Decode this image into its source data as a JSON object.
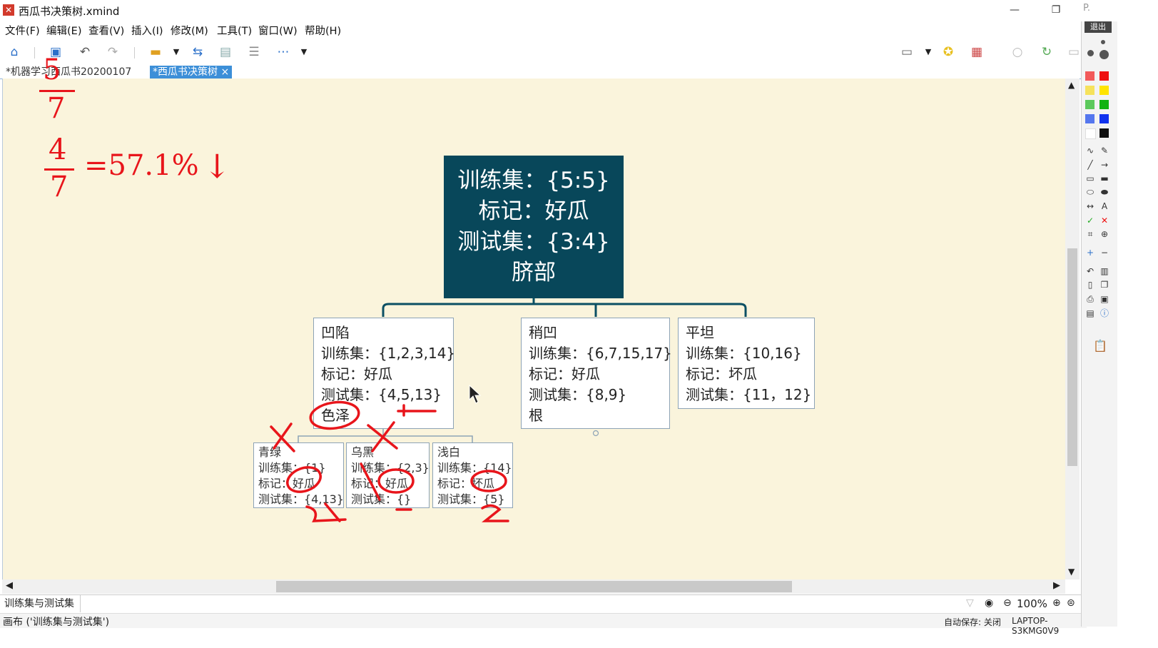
{
  "window": {
    "title": "西瓜书决策树.xmind",
    "minimize": "—",
    "restore": "❐",
    "close_tab_label": "P."
  },
  "menu": [
    "文件(F)",
    "编辑(E)",
    "查看(V)",
    "插入(I)",
    "修改(M)",
    "工具(T)",
    "窗口(W)",
    "帮助(H)"
  ],
  "tabs": [
    {
      "label": "*机器学习西瓜书20200107"
    },
    {
      "label": "*西瓜书决策树",
      "close": "×"
    }
  ],
  "mindmap": {
    "root": [
      "训练集：{5:5}",
      "标记：好瓜",
      "测试集：{3:4}",
      "脐部"
    ],
    "branches": [
      {
        "lines": [
          "凹陷",
          "训练集：{1,2,3,14}",
          "标记：好瓜",
          "测试集：{4,5,13}",
          "色泽"
        ]
      },
      {
        "lines": [
          "稍凹",
          "训练集：{6,7,15,17}",
          "标记：好瓜",
          "测试集：{8,9}",
          "根"
        ]
      },
      {
        "lines": [
          "平坦",
          "训练集：{10,16}",
          "标记：坏瓜",
          "测试集：{11，12}"
        ]
      }
    ],
    "sub_branches": [
      {
        "lines": [
          "青绿",
          "训练集：{1}",
          "标记：好瓜",
          "测试集：{4,13}"
        ]
      },
      {
        "lines": [
          "乌黑",
          "训练集：{2,3}",
          "标记：好瓜",
          "测试集：{}"
        ]
      },
      {
        "lines": [
          "浅白",
          "训练集：{14}",
          "标记：坏瓜",
          "测试集：{5}"
        ]
      }
    ]
  },
  "annotations": {
    "frac_top_num": "5",
    "frac_top_den": "7",
    "frac2_num": "4",
    "frac2_den": "7",
    "equals": "=57.1%",
    "arrow": "↓",
    "marks_x": "X",
    "check_plus": "+",
    "marks_count_1": "2✕",
    "marks_count_3": "2"
  },
  "sheet_tab": "训练集与测试集",
  "zoom": "100%",
  "status": {
    "left": "画布 ('训练集与测试集')",
    "autosave": "自动保存: 关闭",
    "computer": "LAPTOP-S3KMG0V9"
  },
  "palette": {
    "exit_label": "退出",
    "colors": [
      "#f25a5a",
      "#ee1111",
      "#f6e25c",
      "#ffe400",
      "#5cc95c",
      "#12b312",
      "#5577ee",
      "#1133ee",
      "#ffffff",
      "#111111"
    ]
  }
}
